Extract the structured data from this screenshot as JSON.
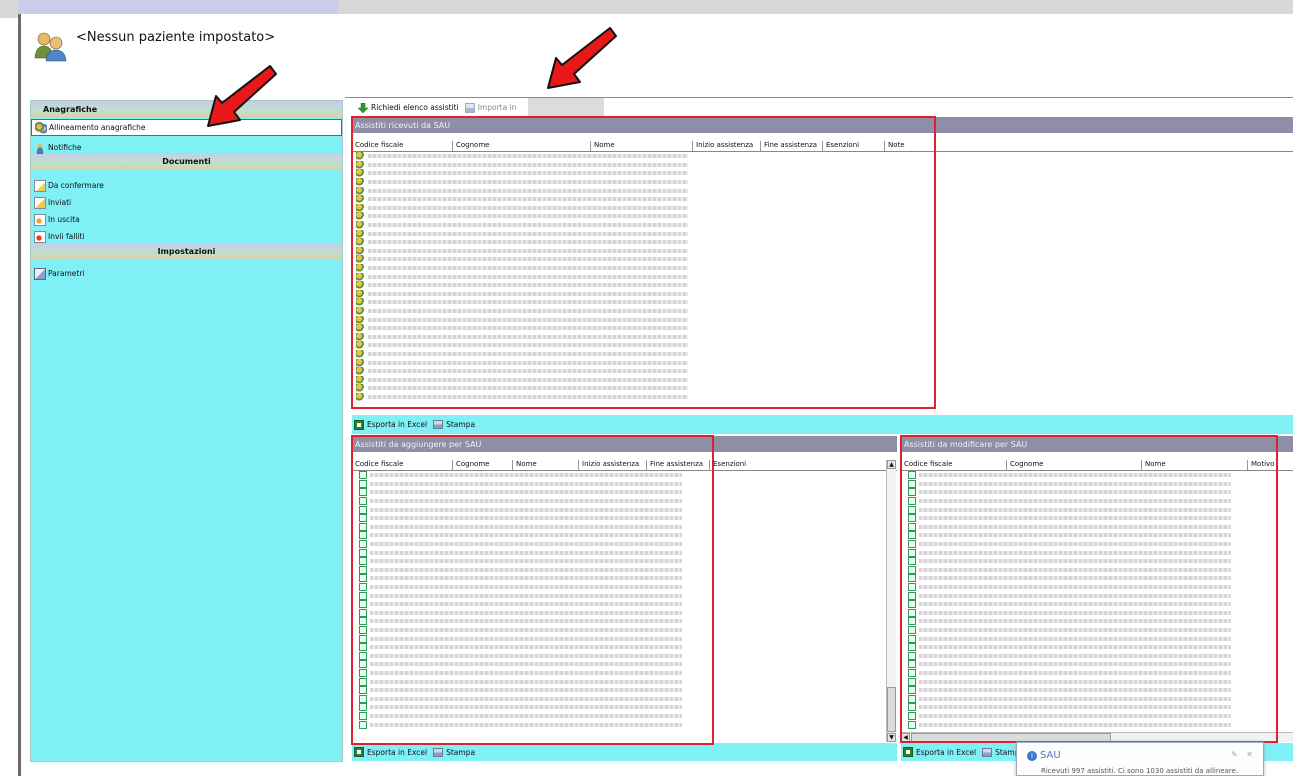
{
  "header": {
    "patient": "<Nessun paziente impostato>"
  },
  "sidebar": {
    "sections": [
      {
        "title": "Anagrafiche",
        "items": [
          {
            "label": "Allineamento anagrafiche",
            "icon": "users-sync-icon",
            "selected": true
          },
          {
            "label": "Notifiche",
            "icon": "person-icon"
          }
        ]
      },
      {
        "title": "Documenti",
        "items": [
          {
            "label": "Da confermare",
            "icon": "doc-confirm-icon"
          },
          {
            "label": "Inviati",
            "icon": "doc-sent-icon"
          },
          {
            "label": "In uscita",
            "icon": "doc-outgoing-icon"
          },
          {
            "label": "Invii falliti",
            "icon": "doc-failed-icon"
          }
        ]
      },
      {
        "title": "Impostazioni",
        "items": [
          {
            "label": "Parametri",
            "icon": "settings-icon"
          }
        ]
      }
    ]
  },
  "toolbar": {
    "request_label": "Richiedi elenco assistiti",
    "import_label": "Importa in"
  },
  "received": {
    "title": "Assistiti ricevuti da SAU",
    "columns": [
      "Codice fiscale",
      "Cognome",
      "Nome",
      "Inizio assistenza",
      "Fine assistenza",
      "Esenzioni",
      "Note"
    ]
  },
  "to_add": {
    "title": "Assistiti da aggiungere per SAU",
    "columns": [
      "Codice fiscale",
      "Cognome",
      "Nome",
      "Inizio assistenza",
      "Fine assistenza",
      "Esenzioni"
    ]
  },
  "to_modify": {
    "title": "Assistiti da modificare per SAU",
    "columns": [
      "Codice fiscale",
      "Cognome",
      "Nome",
      "Motivo"
    ]
  },
  "actions": {
    "export_excel": "Esporta in Excel",
    "print": "Stampa"
  },
  "toast": {
    "title": "SAU",
    "message": "Ricevuti 997 assistiti. Ci sono 1030 assistiti da allineare."
  },
  "colors": {
    "sidebar_bg": "#7ff0f6",
    "panel_title_bg": "#8e8ea6",
    "highlight_red": "#e02030"
  }
}
